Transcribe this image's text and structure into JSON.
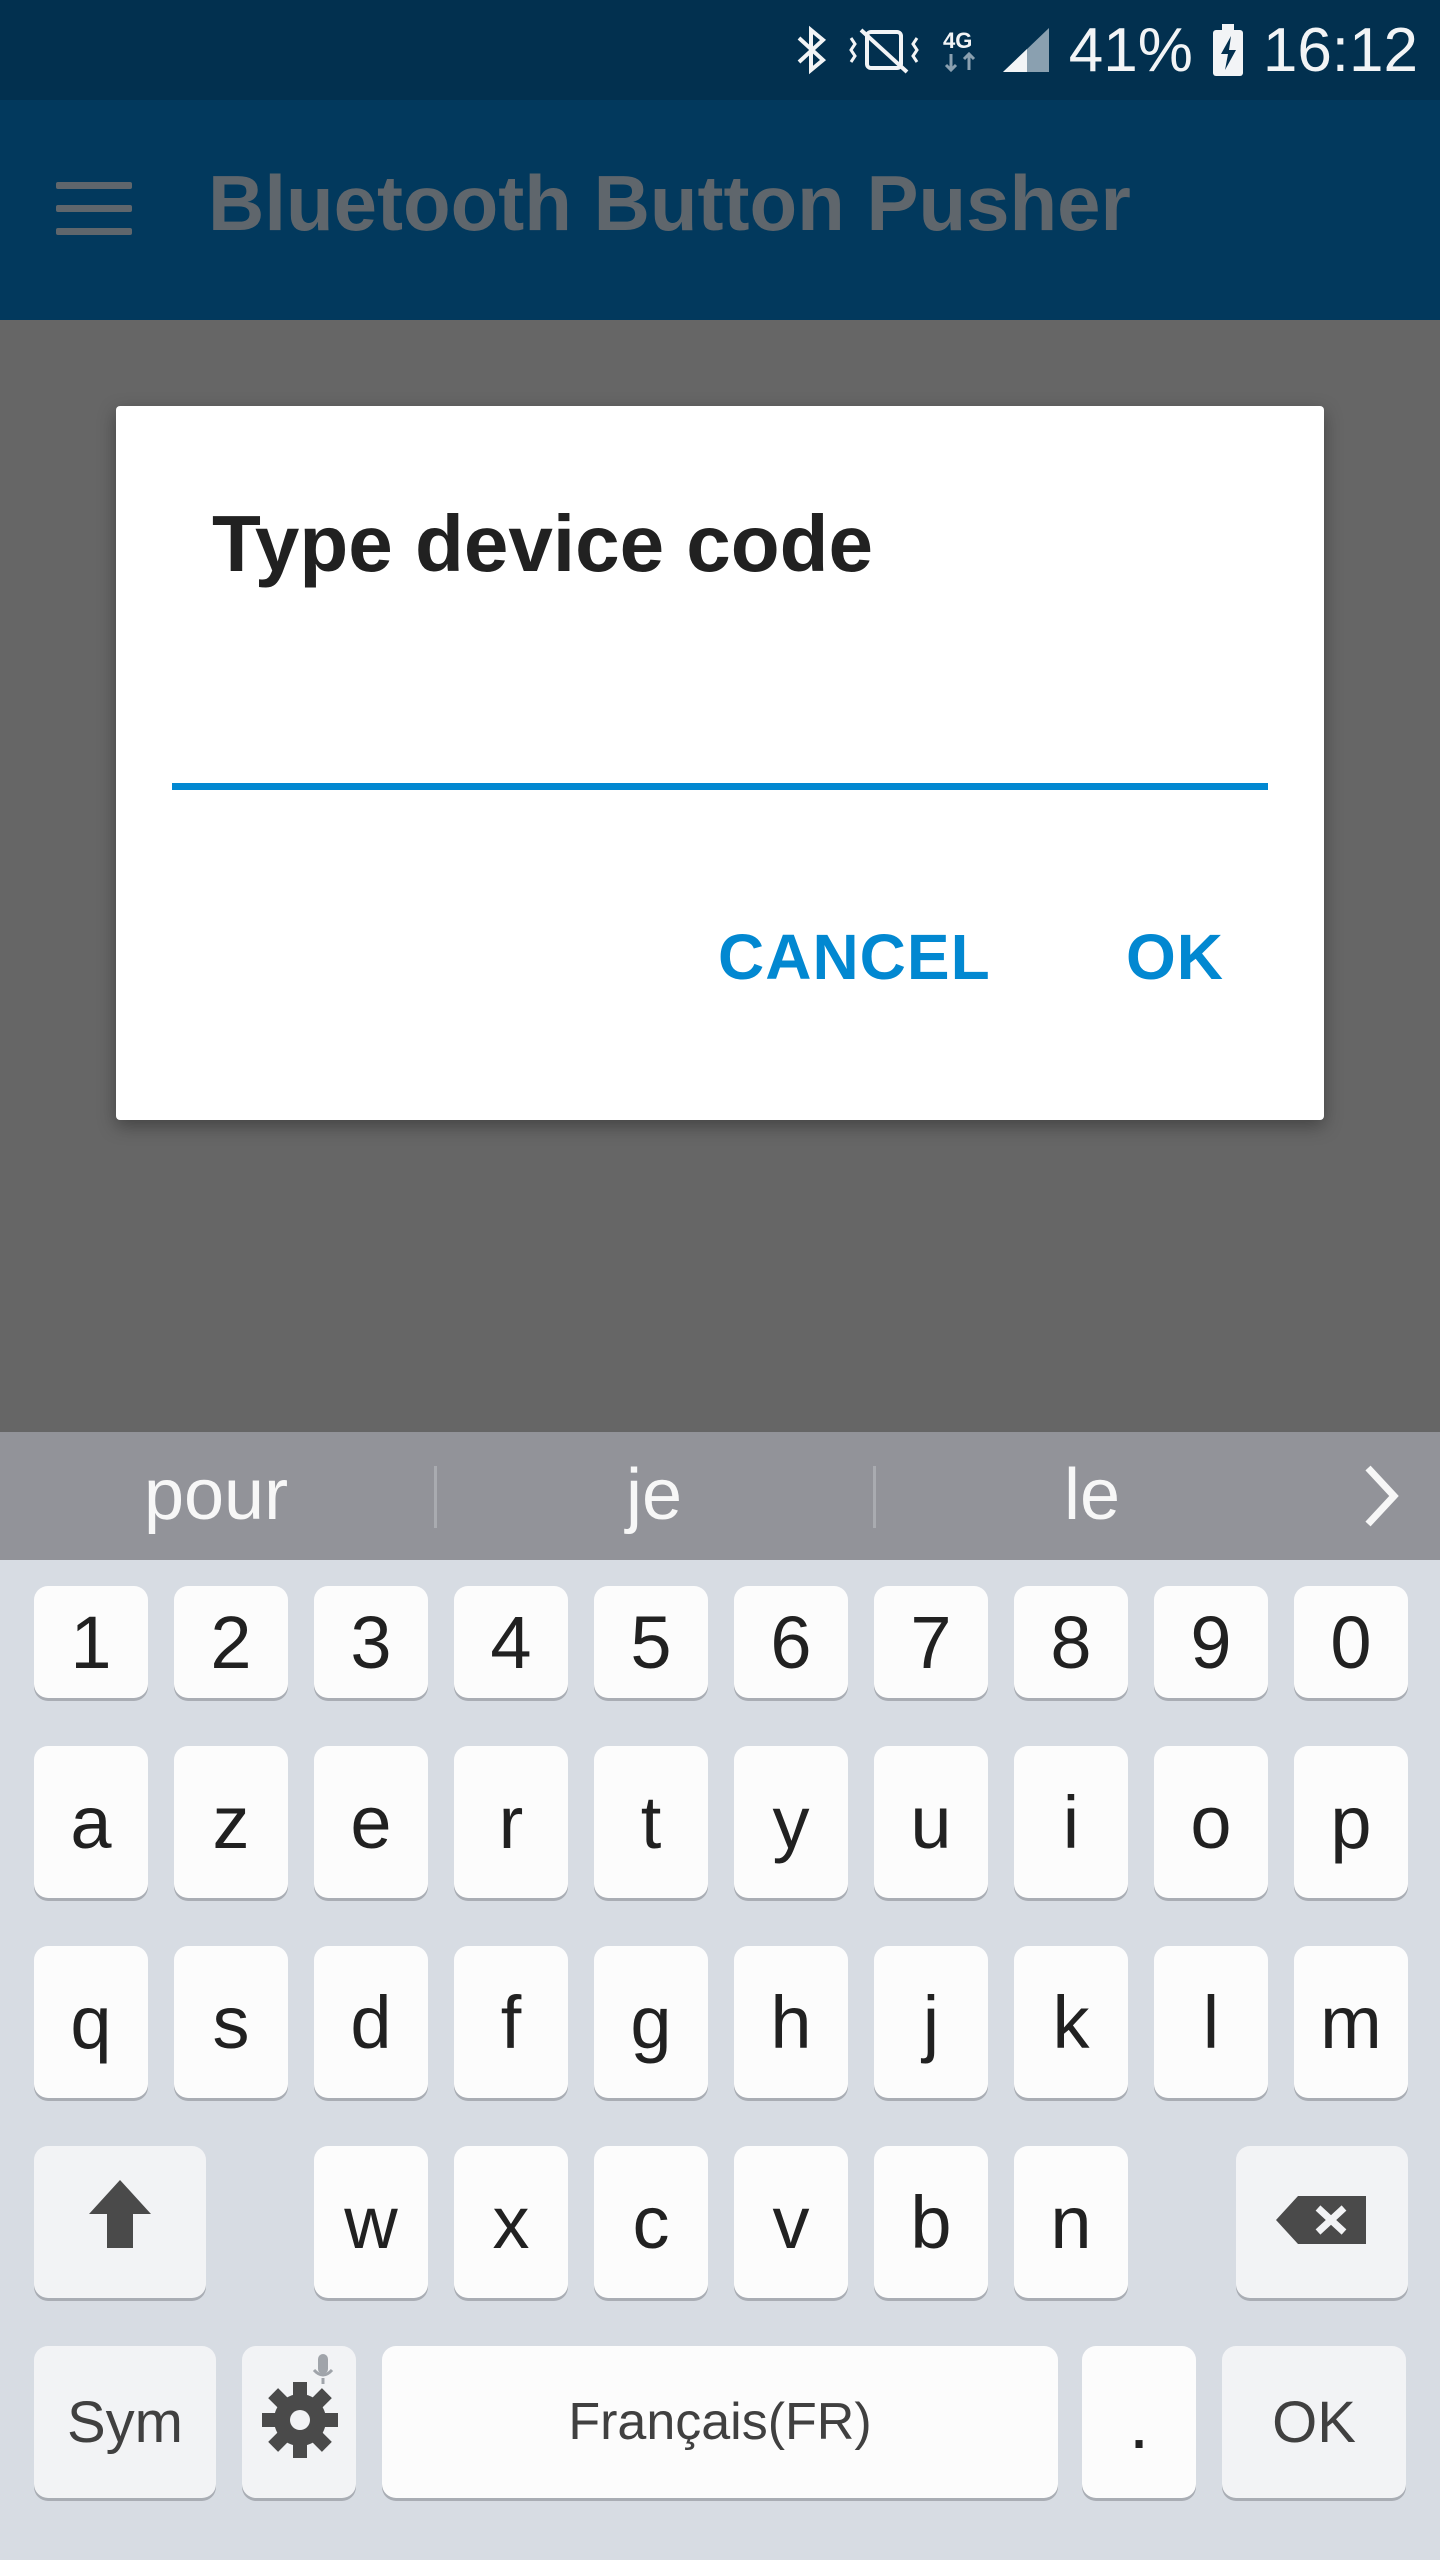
{
  "status_bar": {
    "battery": "41%",
    "time": "16:12",
    "network": "4G",
    "icons": [
      "bluetooth-icon",
      "vibrate-mute-icon",
      "network-4g-icon",
      "signal-icon",
      "battery-charging-icon"
    ]
  },
  "app_bar": {
    "title": "Bluetooth Button Pusher",
    "menu_icon": "menu-icon"
  },
  "dialog": {
    "title": "Type device code",
    "input_value": "",
    "input_placeholder": "",
    "cancel_label": "CANCEL",
    "ok_label": "OK",
    "accent_color": "#0288d1"
  },
  "keyboard": {
    "suggestions": [
      "pour",
      "je",
      "le"
    ],
    "row_numbers": [
      "1",
      "2",
      "3",
      "4",
      "5",
      "6",
      "7",
      "8",
      "9",
      "0"
    ],
    "row_1": [
      "a",
      "z",
      "e",
      "r",
      "t",
      "y",
      "u",
      "i",
      "o",
      "p"
    ],
    "row_2": [
      "q",
      "s",
      "d",
      "f",
      "g",
      "h",
      "j",
      "k",
      "l",
      "m"
    ],
    "row_3": [
      "w",
      "x",
      "c",
      "v",
      "b",
      "n"
    ],
    "sym_label": "Sym",
    "space_label": "Français(FR)",
    "period_label": ".",
    "enter_label": "OK"
  }
}
